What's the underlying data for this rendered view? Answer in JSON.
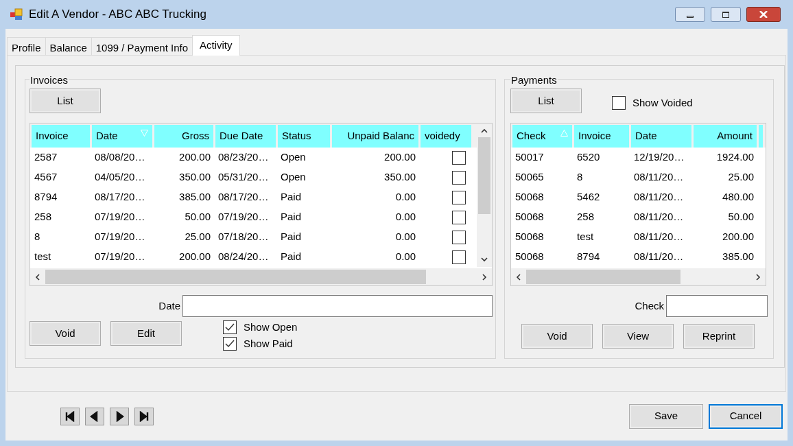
{
  "window": {
    "title": "Edit A Vendor - ABC ABC Trucking"
  },
  "tabs": [
    {
      "label": "Profile",
      "selected": false
    },
    {
      "label": "Balance",
      "selected": false
    },
    {
      "label": "1099 / Payment Info",
      "selected": false
    },
    {
      "label": "Activity",
      "selected": true
    }
  ],
  "invoices": {
    "title": "Invoices",
    "list_button": "List",
    "columns": [
      {
        "label": "Invoice",
        "right_aligned": false,
        "sort_ascending": false,
        "sort_descending": false
      },
      {
        "label": "Date",
        "right_aligned": false,
        "sort_ascending": false,
        "sort_descending": true
      },
      {
        "label": "Gross",
        "right_aligned": true,
        "sort_ascending": false,
        "sort_descending": false
      },
      {
        "label": "Due Date",
        "right_aligned": false,
        "sort_ascending": false,
        "sort_descending": false
      },
      {
        "label": "Status",
        "right_aligned": false,
        "sort_ascending": false,
        "sort_descending": false
      },
      {
        "label": "Unpaid Balanc",
        "right_aligned": true,
        "sort_ascending": false,
        "sort_descending": false
      },
      {
        "label": "voidedy",
        "right_aligned": false,
        "sort_ascending": false,
        "sort_descending": false
      }
    ],
    "rows": [
      {
        "cells": [
          "2587",
          "08/08/20…",
          "200.00",
          "08/23/20…",
          "Open",
          "200.00"
        ],
        "voided": false
      },
      {
        "cells": [
          "4567",
          "04/05/20…",
          "350.00",
          "05/31/20…",
          "Open",
          "350.00"
        ],
        "voided": false
      },
      {
        "cells": [
          "8794",
          "08/17/20…",
          "385.00",
          "08/17/20…",
          "Paid",
          "0.00"
        ],
        "voided": false
      },
      {
        "cells": [
          "258",
          "07/19/20…",
          "50.00",
          "07/19/20…",
          "Paid",
          "0.00"
        ],
        "voided": false
      },
      {
        "cells": [
          "8",
          "07/19/20…",
          "25.00",
          "07/18/20…",
          "Paid",
          "0.00"
        ],
        "voided": false
      },
      {
        "cells": [
          "test",
          "07/19/20…",
          "200.00",
          "08/24/20…",
          "Paid",
          "0.00"
        ],
        "voided": false
      }
    ],
    "date_label": "Date",
    "buttons": [
      "Void",
      "Edit"
    ],
    "filters": [
      {
        "label": "Show Open",
        "checked": true
      },
      {
        "label": "Show Paid",
        "checked": true
      }
    ]
  },
  "payments": {
    "title": "Payments",
    "list_button": "List",
    "show_voided": {
      "label": "Show Voided",
      "checked": false
    },
    "columns": [
      {
        "label": "Check",
        "right_aligned": false,
        "sort_ascending": true,
        "sort_descending": false
      },
      {
        "label": "Invoice",
        "right_aligned": false,
        "sort_ascending": false,
        "sort_descending": false
      },
      {
        "label": "Date",
        "right_aligned": false,
        "sort_ascending": false,
        "sort_descending": false
      },
      {
        "label": "Amount",
        "right_aligned": true,
        "sort_ascending": false,
        "sort_descending": false
      }
    ],
    "rows": [
      {
        "cells": [
          "50017",
          "6520",
          "12/19/20…",
          "1924.00"
        ]
      },
      {
        "cells": [
          "50065",
          "8",
          "08/11/20…",
          "25.00"
        ]
      },
      {
        "cells": [
          "50068",
          "5462",
          "08/11/20…",
          "480.00"
        ]
      },
      {
        "cells": [
          "50068",
          "258",
          "08/11/20…",
          "50.00"
        ]
      },
      {
        "cells": [
          "50068",
          "test",
          "08/11/20…",
          "200.00"
        ]
      },
      {
        "cells": [
          "50068",
          "8794",
          "08/11/20…",
          "385.00"
        ]
      }
    ],
    "check_label": "Check",
    "buttons": [
      "Void",
      "View",
      "Reprint"
    ]
  },
  "footer": {
    "buttons": [
      {
        "label": "Save",
        "focused": false
      },
      {
        "label": "Cancel",
        "focused": true
      }
    ]
  }
}
